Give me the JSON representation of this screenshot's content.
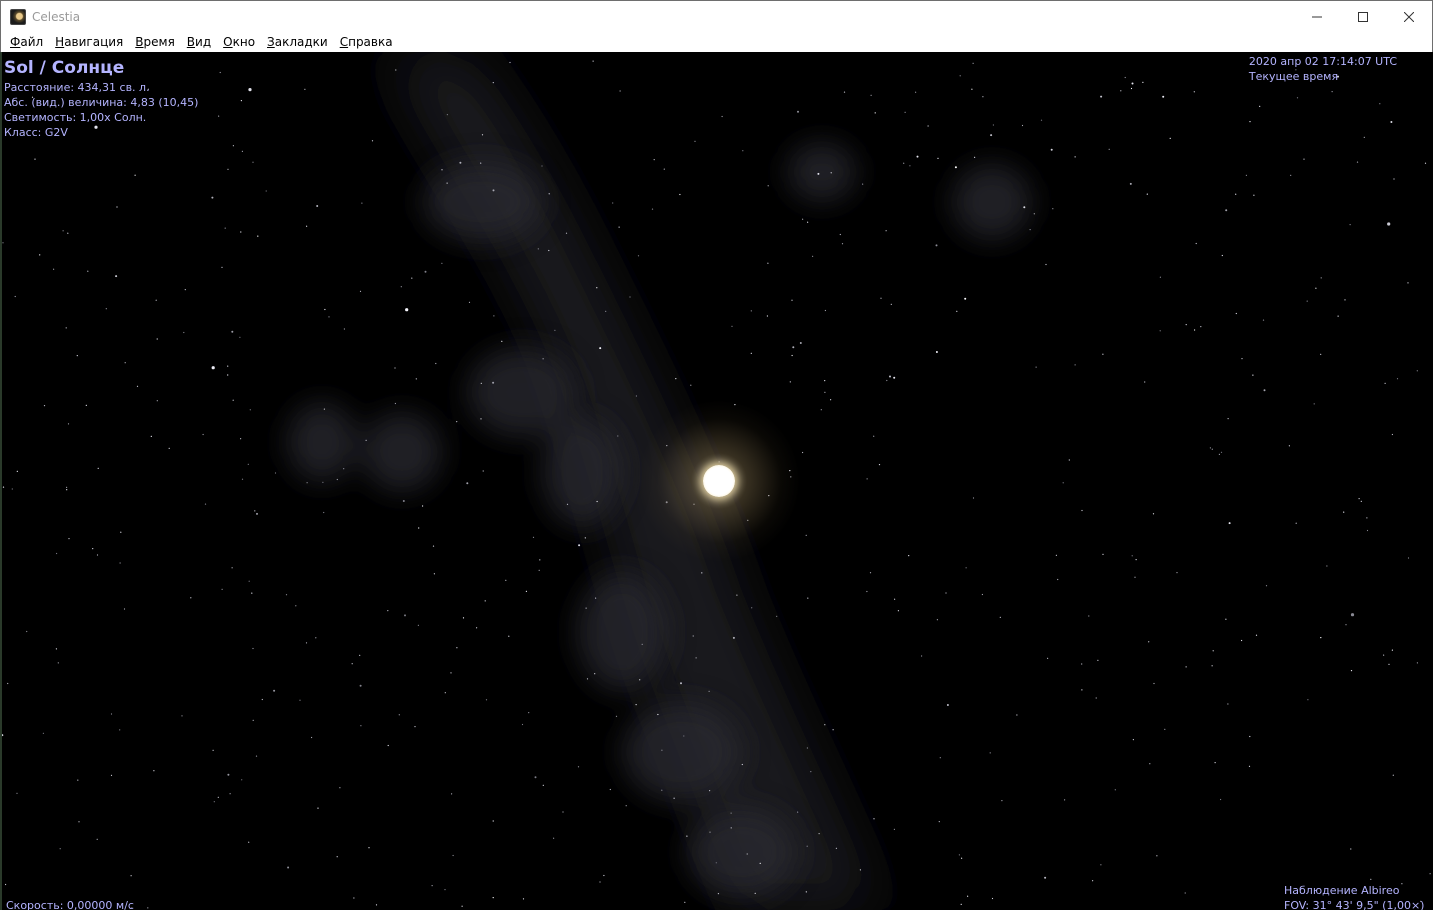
{
  "window": {
    "title": "Celestia",
    "minimize_glyph": "—",
    "maximize_glyph": "☐",
    "close_glyph": "✕"
  },
  "menu": [
    {
      "label": "Файл",
      "accel": "Ф",
      "rest": "айл"
    },
    {
      "label": "Навигация",
      "accel": "Н",
      "rest": "авигация"
    },
    {
      "label": "Время",
      "accel": "В",
      "rest": "ремя"
    },
    {
      "label": "Вид",
      "accel": "В",
      "rest": "ид"
    },
    {
      "label": "Окно",
      "accel": "О",
      "rest": "кно"
    },
    {
      "label": "Закладки",
      "accel": "З",
      "rest": "акладки"
    },
    {
      "label": "Справка",
      "accel": "С",
      "rest": "правка"
    }
  ],
  "object_info": {
    "name": "Sol / Солнце",
    "distance": "Расстояние: 434,31 св. л.",
    "magnitude": "Абс. (вид.) величина: 4,83 (10,45)",
    "luminosity": "Светимость: 1,00x Солн.",
    "class": "Класс: G2V"
  },
  "time": {
    "datetime": "2020 апр 02 17:14:07 UTC",
    "mode": "Текущее время"
  },
  "status": {
    "speed": "Скорость: 0,00000 м/с",
    "observing": "Наблюдение Albireo",
    "fov": "FOV: 31° 43' 9,5\" (1,00×)"
  },
  "colors": {
    "hud_text": "#b4b4ff",
    "background": "#000000"
  }
}
